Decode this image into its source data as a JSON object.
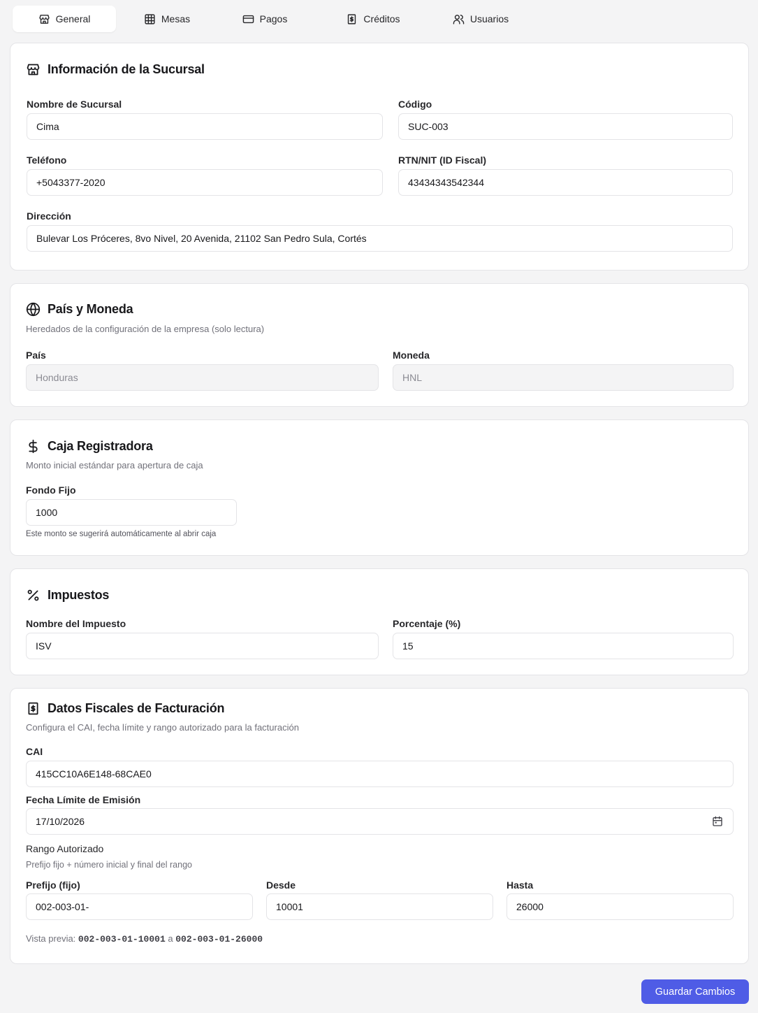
{
  "tabs": [
    {
      "label": "General",
      "icon": "store-icon",
      "active": true
    },
    {
      "label": "Mesas",
      "icon": "table-grid-icon",
      "active": false
    },
    {
      "label": "Pagos",
      "icon": "credit-card-icon",
      "active": false
    },
    {
      "label": "Créditos",
      "icon": "receipt-icon",
      "active": false
    },
    {
      "label": "Usuarios",
      "icon": "users-icon",
      "active": false
    }
  ],
  "branch_info": {
    "title": "Información de la Sucursal",
    "icon": "store-icon",
    "name_label": "Nombre de Sucursal",
    "name_value": "Cima",
    "code_label": "Código",
    "code_value": "SUC-003",
    "phone_label": "Teléfono",
    "phone_value": "+5043377-2020",
    "tax_id_label": "RTN/NIT (ID Fiscal)",
    "tax_id_value": "43434343542344",
    "address_label": "Dirección",
    "address_value": "Bulevar Los Próceres, 8vo Nivel, 20 Avenida, 21102 San Pedro Sula, Cortés"
  },
  "country_currency": {
    "title": "País y Moneda",
    "icon": "globe-icon",
    "description": "Heredados de la configuración de la empresa (solo lectura)",
    "country_label": "País",
    "country_value": "Honduras",
    "currency_label": "Moneda",
    "currency_value": "HNL"
  },
  "cash_register": {
    "title": "Caja Registradora",
    "icon": "dollar-icon",
    "description": "Monto inicial estándar para apertura de caja",
    "fund_label": "Fondo Fijo",
    "fund_value": "1000",
    "fund_hint": "Este monto se sugerirá automáticamente al abrir caja"
  },
  "taxes": {
    "title": "Impuestos",
    "icon": "percent-icon",
    "tax_name_label": "Nombre del Impuesto",
    "tax_name_value": "ISV",
    "percentage_label": "Porcentaje (%)",
    "percentage_value": "15"
  },
  "fiscal": {
    "title": "Datos Fiscales de Facturación",
    "icon": "receipt-icon",
    "description": "Configura el CAI, fecha límite y rango autorizado para la facturación",
    "cai_label": "CAI",
    "cai_value": "415CC10A6E148-68CAE0",
    "deadline_label": "Fecha Límite de Emisión",
    "deadline_value": "17/10/2026",
    "range_label": "Rango Autorizado",
    "range_desc": "Prefijo fijo + número inicial y final del rango",
    "prefix_label": "Prefijo (fijo)",
    "prefix_value": "002-003-01-",
    "from_label": "Desde",
    "from_value": "10001",
    "to_label": "Hasta",
    "to_value": "26000",
    "preview_label": "Vista previa:",
    "preview_from": "002-003-01-10001",
    "preview_sep": "a",
    "preview_to": "002-003-01-26000"
  },
  "actions": {
    "save_label": "Guardar Cambios"
  },
  "colors": {
    "accent": "#4f5ce6",
    "background": "#f4f4f5",
    "card": "#ffffff",
    "border": "#e4e4e7"
  }
}
